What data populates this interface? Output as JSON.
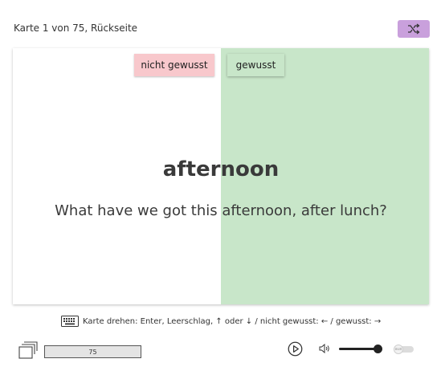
{
  "header": {
    "card_status": "Karte 1 von 75, Rückseite"
  },
  "toolbar": {
    "shuffle_icon": "shuffle-icon",
    "shuffle_color": "#c9a0dc"
  },
  "card": {
    "not_known_label": "nicht gewusst",
    "known_label": "gewusst",
    "word": "afternoon",
    "sentence": "What have we got this afternoon, after lunch?",
    "not_known_color": "#f8c8cc",
    "known_color": "#c8e6c9"
  },
  "hint": {
    "text": "Karte drehen: Enter, Leerschlag, ↑ oder ↓ / nicht gewusst: ← / gewusst: →",
    "icon": "keyboard-icon"
  },
  "footer": {
    "stack_icon": "card-stack-icon",
    "progress_value": "75",
    "play_icon": "play-icon",
    "volume_icon": "volume-icon",
    "volume_level": 0.9,
    "toggle_label": "aus",
    "toggle_state": "off"
  }
}
